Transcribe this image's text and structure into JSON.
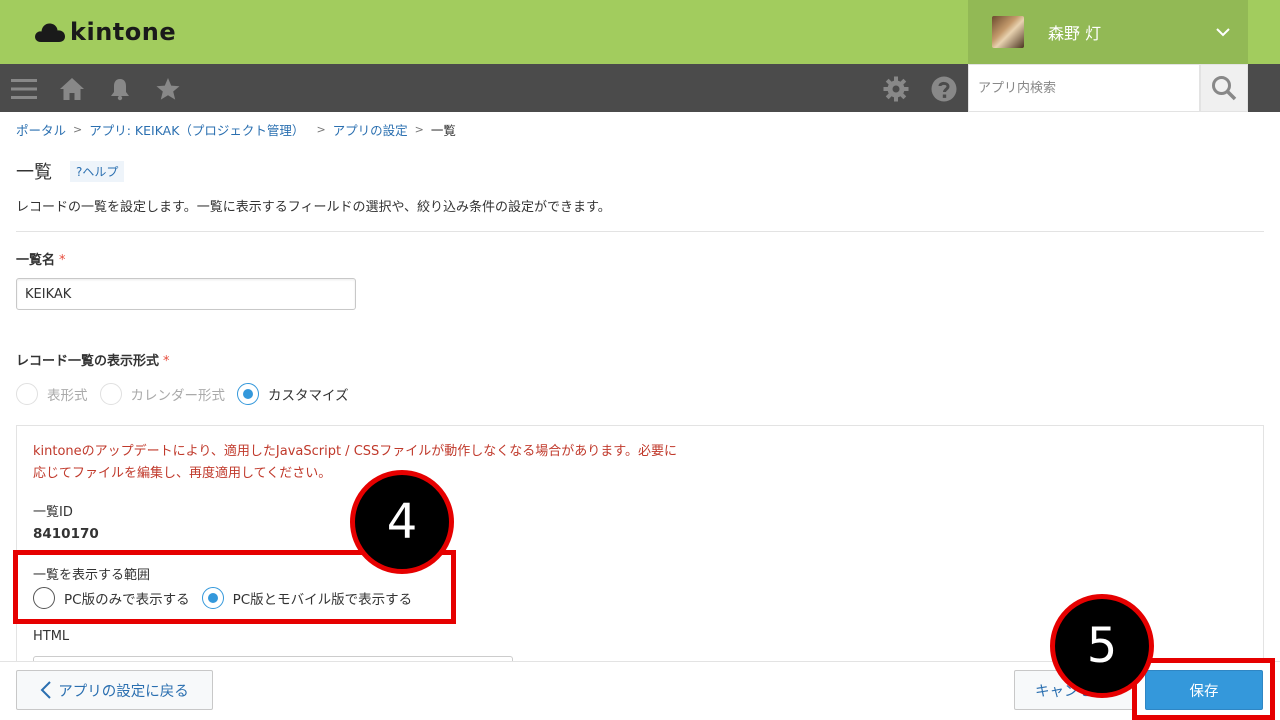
{
  "header": {
    "logo_text": "kintone",
    "user_name": "森野 灯"
  },
  "nav": {
    "search_placeholder": "アプリ内検索"
  },
  "breadcrumb": {
    "portal": "ポータル",
    "app": "アプリ: KEIKAK（プロジェクト管理）",
    "settings": "アプリの設定",
    "current": "一覧",
    "sep": ">"
  },
  "page": {
    "title": "一覧",
    "help": "?ヘルプ",
    "description": "レコードの一覧を設定します。一覧に表示するフィールドの選択や、絞り込み条件の設定ができます。"
  },
  "form": {
    "name_label": "一覧名",
    "required_mark": "*",
    "name_value": "KEIKAK",
    "format_label": "レコード一覧の表示形式",
    "format_options": [
      "表形式",
      "カレンダー形式",
      "カスタマイズ"
    ],
    "format_selected": "カスタマイズ",
    "warning_line1": "kintoneのアップデートにより、適用したJavaScript / CSSファイルが動作しなくなる場合があります。必要に",
    "warning_line2": "応じてファイルを編集し、再度適用してください。",
    "view_id_label": "一覧ID",
    "view_id_value": "8410170",
    "scope_label": "一覧を表示する範囲",
    "scope_options": [
      "PC版のみで表示する",
      "PC版とモバイル版で表示する"
    ],
    "scope_selected": "PC版とモバイル版で表示する",
    "html_label": "HTML"
  },
  "footer": {
    "back_label": "アプリの設定に戻る",
    "cancel_label": "キャンセル",
    "save_label": "保存"
  },
  "annotations": {
    "step4": "4",
    "step5": "5"
  },
  "colors": {
    "header_green": "#a2cc5e",
    "nav_dark": "#4b4b4b",
    "link_blue": "#2a6fb0",
    "accent_blue": "#3498db",
    "warning_red": "#c0392b",
    "annotation_red": "#e60000"
  }
}
